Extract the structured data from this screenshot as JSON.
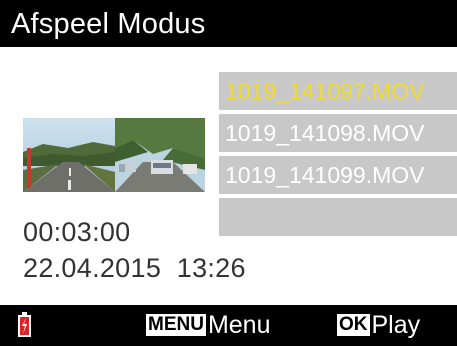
{
  "header": {
    "title": "Afspeel Modus"
  },
  "preview": {
    "thumbnail": "dashcam-road-thumbnail"
  },
  "files": [
    {
      "name": "1019_141097.MOV",
      "selected": true
    },
    {
      "name": "1019_141098.MOV",
      "selected": false
    },
    {
      "name": "1019_141099.MOV",
      "selected": false
    },
    {
      "name": "",
      "selected": false
    }
  ],
  "info": {
    "duration": "00:03:00",
    "date": "22.04.2015",
    "time": "13:26"
  },
  "footer": {
    "battery_icon": "battery-low-icon",
    "menu_key": "MENU",
    "menu_label": "Menu",
    "ok_key": "OK",
    "ok_label": "Play"
  },
  "colors": {
    "bar": "#000000",
    "list_bg": "#c8c8c8",
    "selected_text": "#f0dc2a",
    "battery": "#e02222"
  }
}
